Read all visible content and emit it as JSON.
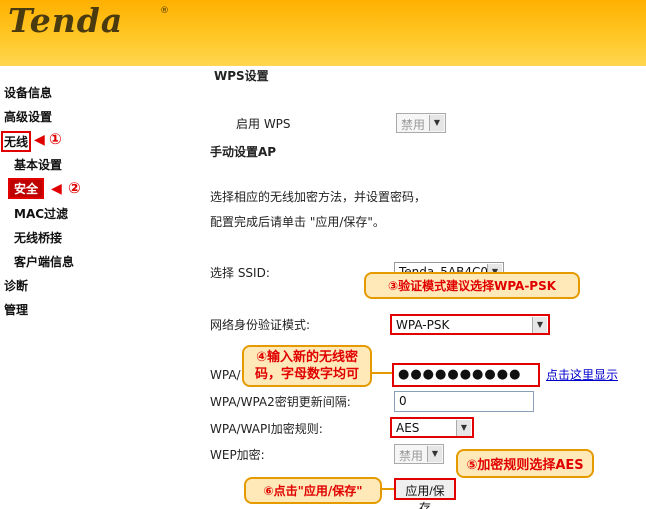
{
  "header": {
    "logo": "Tenda",
    "logo_mark": "®"
  },
  "sidebar": {
    "items": [
      {
        "label": "设备信息"
      },
      {
        "label": "高级设置"
      },
      {
        "label": "无线"
      },
      {
        "label": "基本设置"
      },
      {
        "label": "安全"
      },
      {
        "label": "MAC过滤"
      },
      {
        "label": "无线桥接"
      },
      {
        "label": "客户端信息"
      },
      {
        "label": "诊断"
      },
      {
        "label": "管理"
      }
    ],
    "markers": {
      "m1": "①",
      "m2": "②"
    }
  },
  "main": {
    "wps_title": "WPS设置",
    "wps_enable_label": "启用 WPS",
    "wps_enable_value": "禁用",
    "manual_ap_title": "手动设置AP",
    "desc_line1": "选择相应的无线加密方法，并设置密码，",
    "desc_line2": "配置完成后请单击 \"应用/保存\"。",
    "ssid_label": "选择 SSID:",
    "ssid_value": "Tenda_5AB4C0",
    "auth_label": "网络身份验证模式:",
    "auth_value": "WPA-PSK",
    "wpa_key_label": "WPA/",
    "wpa_key_value": "●●●●●●●●●●",
    "show_link": "点击这里显示",
    "rekey_label": "WPA/WPA2密钥更新间隔:",
    "rekey_value": "0",
    "encrypt_label": "WPA/WAPI加密规则:",
    "encrypt_value": "AES",
    "wep_label": "WEP加密:",
    "wep_value": "禁用",
    "apply_button": "应用/保存"
  },
  "callouts": {
    "c3": "③验证模式建议选择WPA-PSK",
    "c4_line1": "④输入新的无线密",
    "c4_line2": "码，字母数字均可",
    "c5": "⑤加密规则选择AES",
    "c6": "⑥点击\"应用/保存\""
  },
  "colors": {
    "header": "#ffc726",
    "annotation_red": "#e00000",
    "callout_bg": "#ffe9b8",
    "callout_border": "#e59a00"
  }
}
